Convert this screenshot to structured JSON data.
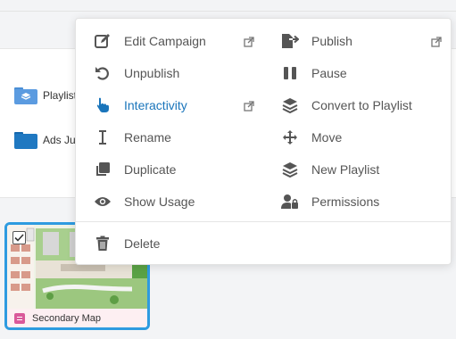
{
  "folders": [
    {
      "name": "Playlists"
    },
    {
      "name": "Ads July"
    }
  ],
  "card": {
    "title": "Secondary Map"
  },
  "menu": {
    "left": [
      {
        "label": "Edit Campaign",
        "icon": "edit-icon"
      },
      {
        "label": "Unpublish",
        "icon": "undo-icon"
      },
      {
        "label": "Interactivity",
        "icon": "hand-pointer-icon"
      },
      {
        "label": "Rename",
        "icon": "text-cursor-icon"
      },
      {
        "label": "Duplicate",
        "icon": "duplicate-icon"
      },
      {
        "label": "Show Usage",
        "icon": "eye-icon"
      }
    ],
    "right": [
      {
        "label": "Publish",
        "icon": "file-export-icon"
      },
      {
        "label": "Pause",
        "icon": "pause-icon"
      },
      {
        "label": "Convert to Playlist",
        "icon": "layers-icon"
      },
      {
        "label": "Move",
        "icon": "move-arrows-icon"
      },
      {
        "label": "New Playlist",
        "icon": "layers-icon"
      },
      {
        "label": "Permissions",
        "icon": "user-lock-icon"
      }
    ],
    "bottom": {
      "label": "Delete",
      "icon": "trash-icon"
    }
  },
  "colors": {
    "accent": "#1a75bb",
    "card_border": "#2e9be0",
    "folder": "#1f78c1"
  }
}
